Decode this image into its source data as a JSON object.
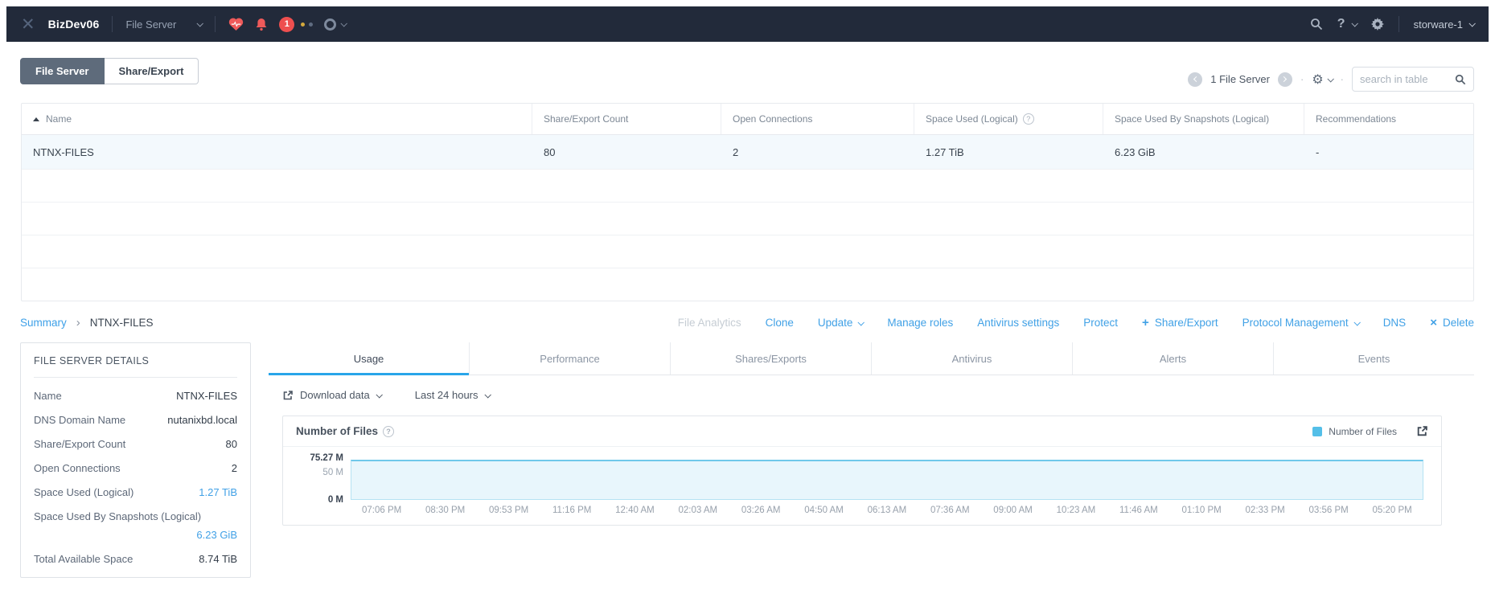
{
  "navbar": {
    "brand": "BizDev06",
    "context_selector": "File Server",
    "alert_count": "1",
    "help_label": "?",
    "username": "storware-1"
  },
  "view_tabs": {
    "file_server": "File Server",
    "share_export": "Share/Export"
  },
  "table_toolbar": {
    "count_label": "1 File Server",
    "search_placeholder": "search in table"
  },
  "table": {
    "columns": [
      "Name",
      "Share/Export Count",
      "Open Connections",
      "Space Used (Logical)",
      "Space Used By Snapshots (Logical)",
      "Recommendations"
    ],
    "rows": [
      {
        "name": "NTNX-FILES",
        "share_export_count": "80",
        "open_connections": "2",
        "space_used": "1.27 TiB",
        "space_snapshots": "6.23 GiB",
        "recommendations": "-"
      }
    ]
  },
  "breadcrumb": {
    "parent": "Summary",
    "separator": "›",
    "current": "NTNX-FILES"
  },
  "actions": {
    "file_analytics": "File Analytics",
    "clone": "Clone",
    "update": "Update",
    "manage_roles": "Manage roles",
    "antivirus_settings": "Antivirus settings",
    "protect": "Protect",
    "share_export": "Share/Export",
    "protocol_management": "Protocol Management",
    "dns": "DNS",
    "delete": "Delete",
    "plus": "+",
    "x": "×"
  },
  "details": {
    "title": "FILE SERVER DETAILS",
    "rows": [
      {
        "label": "Name",
        "value": "NTNX-FILES"
      },
      {
        "label": "DNS Domain Name",
        "value": "nutanixbd.local"
      },
      {
        "label": "Share/Export Count",
        "value": "80"
      },
      {
        "label": "Open Connections",
        "value": "2"
      },
      {
        "label": "Space Used (Logical)",
        "value": "1.27 TiB"
      },
      {
        "label": "Space Used By Snapshots (Logical)",
        "value": "6.23 GiB"
      },
      {
        "label": "Total Available Space",
        "value": "8.74 TiB"
      }
    ]
  },
  "detail_tabs": [
    "Usage",
    "Performance",
    "Shares/Exports",
    "Antivirus",
    "Alerts",
    "Events"
  ],
  "chart_controls": {
    "download": "Download data",
    "range": "Last 24 hours"
  },
  "chart_data": {
    "type": "area",
    "title": "Number of Files",
    "legend": [
      "Number of Files"
    ],
    "legend_position": "top-right",
    "color": "#54bfe8",
    "x_labels": [
      "07:06 PM",
      "08:30 PM",
      "09:53 PM",
      "11:16 PM",
      "12:40 AM",
      "02:03 AM",
      "03:26 AM",
      "04:50 AM",
      "06:13 AM",
      "07:36 AM",
      "09:00 AM",
      "10:23 AM",
      "11:46 AM",
      "01:10 PM",
      "02:33 PM",
      "03:56 PM",
      "05:20 PM"
    ],
    "series": [
      {
        "name": "Number of Files",
        "values": [
          75.27,
          75.27,
          75.27,
          75.27,
          75.27,
          75.27,
          75.27,
          75.27,
          75.27,
          75.27,
          75.27,
          75.27,
          75.27,
          75.27,
          75.27,
          75.27,
          75.27
        ]
      }
    ],
    "unit": "M",
    "current_value": 75.27,
    "ylim": [
      0,
      78
    ],
    "ytick_labels": [
      "75.27 M",
      "50 M",
      "0 M"
    ],
    "grid": false
  }
}
